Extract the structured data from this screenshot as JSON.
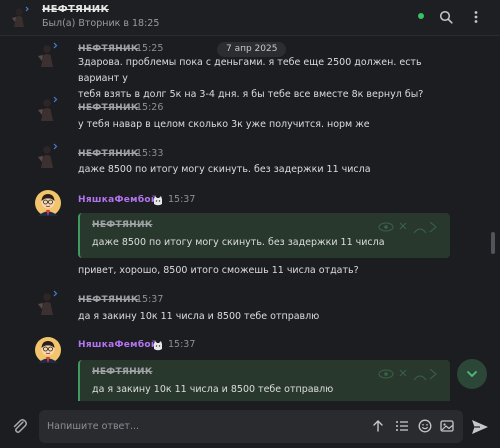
{
  "header": {
    "name": "НЕФТЯНИК",
    "status": "Был(а) Вторник в 18:25"
  },
  "date_pill": "7 апр 2025",
  "messages": [
    {
      "author": "НЕФТЯНИК",
      "time": "15:25",
      "lines": [
        "Здарова. проблемы пока с деньгами. я тебе еще 2500 должен. есть вариант у",
        "тебя взять в долг 5к на 3-4 дня. я бы тебе все вместе 8к вернул бы?"
      ]
    },
    {
      "author": "НЕФТЯНИК",
      "time": "15:26",
      "lines": [
        "у тебя навар в целом сколько 3к уже получится. норм же"
      ]
    },
    {
      "author": "НЕФТЯНИК",
      "time": "15:33",
      "lines": [
        "даже 8500 по итогу могу скинуть. без задержки 11 числа"
      ]
    },
    {
      "author": "НяшкаФембой",
      "time": "15:37",
      "quote_author": "НЕФТЯНИК",
      "quote_text": "даже 8500 по итогу могу скинуть. без задержки 11 числа",
      "lines": [
        "привет, хорошо, 8500 итого сможешь 11 числа отдать?"
      ]
    },
    {
      "author": "НЕФТЯНИК",
      "time": "15:37",
      "lines": [
        "да я закину 10к 11 числа и 8500 тебе отправлю"
      ]
    },
    {
      "author": "НяшкаФембой",
      "time": "15:37",
      "quote_author": "НЕФТЯНИК",
      "quote_text": "да я закину 10к 11 числа и 8500 тебе отправлю",
      "lines": []
    }
  ],
  "composer": {
    "placeholder": "Напишите ответ..."
  },
  "icons": {
    "header": [
      "online-status-dot",
      "search-icon",
      "more-vertical-icon"
    ],
    "composer": [
      "paperclip-icon",
      "arrow-up-icon",
      "list-icon",
      "emoji-icon",
      "image-icon",
      "send-icon"
    ],
    "badge": "cat-badge-icon",
    "scroll": "chevron-down-icon"
  },
  "colors": {
    "background": "#1c1d20",
    "accent_green": "#3f9a5f",
    "quote_background": "#29382d",
    "username_purple": "#b374f0",
    "online": "#37c06a"
  }
}
